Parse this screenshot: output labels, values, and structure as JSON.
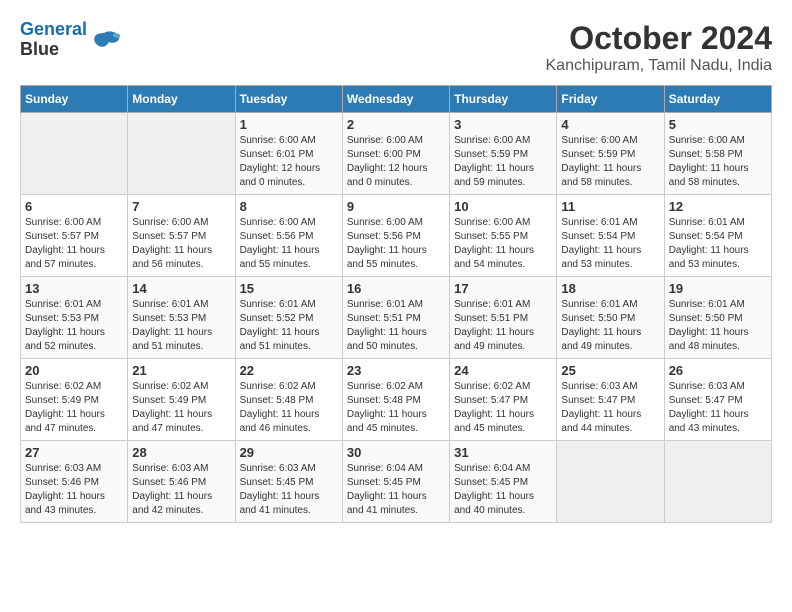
{
  "header": {
    "logo_line1": "General",
    "logo_line2": "Blue",
    "month": "October 2024",
    "location": "Kanchipuram, Tamil Nadu, India"
  },
  "weekdays": [
    "Sunday",
    "Monday",
    "Tuesday",
    "Wednesday",
    "Thursday",
    "Friday",
    "Saturday"
  ],
  "weeks": [
    [
      {
        "day": "",
        "info": ""
      },
      {
        "day": "",
        "info": ""
      },
      {
        "day": "1",
        "info": "Sunrise: 6:00 AM\nSunset: 6:01 PM\nDaylight: 12 hours\nand 0 minutes."
      },
      {
        "day": "2",
        "info": "Sunrise: 6:00 AM\nSunset: 6:00 PM\nDaylight: 12 hours\nand 0 minutes."
      },
      {
        "day": "3",
        "info": "Sunrise: 6:00 AM\nSunset: 5:59 PM\nDaylight: 11 hours\nand 59 minutes."
      },
      {
        "day": "4",
        "info": "Sunrise: 6:00 AM\nSunset: 5:59 PM\nDaylight: 11 hours\nand 58 minutes."
      },
      {
        "day": "5",
        "info": "Sunrise: 6:00 AM\nSunset: 5:58 PM\nDaylight: 11 hours\nand 58 minutes."
      }
    ],
    [
      {
        "day": "6",
        "info": "Sunrise: 6:00 AM\nSunset: 5:57 PM\nDaylight: 11 hours\nand 57 minutes."
      },
      {
        "day": "7",
        "info": "Sunrise: 6:00 AM\nSunset: 5:57 PM\nDaylight: 11 hours\nand 56 minutes."
      },
      {
        "day": "8",
        "info": "Sunrise: 6:00 AM\nSunset: 5:56 PM\nDaylight: 11 hours\nand 55 minutes."
      },
      {
        "day": "9",
        "info": "Sunrise: 6:00 AM\nSunset: 5:56 PM\nDaylight: 11 hours\nand 55 minutes."
      },
      {
        "day": "10",
        "info": "Sunrise: 6:00 AM\nSunset: 5:55 PM\nDaylight: 11 hours\nand 54 minutes."
      },
      {
        "day": "11",
        "info": "Sunrise: 6:01 AM\nSunset: 5:54 PM\nDaylight: 11 hours\nand 53 minutes."
      },
      {
        "day": "12",
        "info": "Sunrise: 6:01 AM\nSunset: 5:54 PM\nDaylight: 11 hours\nand 53 minutes."
      }
    ],
    [
      {
        "day": "13",
        "info": "Sunrise: 6:01 AM\nSunset: 5:53 PM\nDaylight: 11 hours\nand 52 minutes."
      },
      {
        "day": "14",
        "info": "Sunrise: 6:01 AM\nSunset: 5:53 PM\nDaylight: 11 hours\nand 51 minutes."
      },
      {
        "day": "15",
        "info": "Sunrise: 6:01 AM\nSunset: 5:52 PM\nDaylight: 11 hours\nand 51 minutes."
      },
      {
        "day": "16",
        "info": "Sunrise: 6:01 AM\nSunset: 5:51 PM\nDaylight: 11 hours\nand 50 minutes."
      },
      {
        "day": "17",
        "info": "Sunrise: 6:01 AM\nSunset: 5:51 PM\nDaylight: 11 hours\nand 49 minutes."
      },
      {
        "day": "18",
        "info": "Sunrise: 6:01 AM\nSunset: 5:50 PM\nDaylight: 11 hours\nand 49 minutes."
      },
      {
        "day": "19",
        "info": "Sunrise: 6:01 AM\nSunset: 5:50 PM\nDaylight: 11 hours\nand 48 minutes."
      }
    ],
    [
      {
        "day": "20",
        "info": "Sunrise: 6:02 AM\nSunset: 5:49 PM\nDaylight: 11 hours\nand 47 minutes."
      },
      {
        "day": "21",
        "info": "Sunrise: 6:02 AM\nSunset: 5:49 PM\nDaylight: 11 hours\nand 47 minutes."
      },
      {
        "day": "22",
        "info": "Sunrise: 6:02 AM\nSunset: 5:48 PM\nDaylight: 11 hours\nand 46 minutes."
      },
      {
        "day": "23",
        "info": "Sunrise: 6:02 AM\nSunset: 5:48 PM\nDaylight: 11 hours\nand 45 minutes."
      },
      {
        "day": "24",
        "info": "Sunrise: 6:02 AM\nSunset: 5:47 PM\nDaylight: 11 hours\nand 45 minutes."
      },
      {
        "day": "25",
        "info": "Sunrise: 6:03 AM\nSunset: 5:47 PM\nDaylight: 11 hours\nand 44 minutes."
      },
      {
        "day": "26",
        "info": "Sunrise: 6:03 AM\nSunset: 5:47 PM\nDaylight: 11 hours\nand 43 minutes."
      }
    ],
    [
      {
        "day": "27",
        "info": "Sunrise: 6:03 AM\nSunset: 5:46 PM\nDaylight: 11 hours\nand 43 minutes."
      },
      {
        "day": "28",
        "info": "Sunrise: 6:03 AM\nSunset: 5:46 PM\nDaylight: 11 hours\nand 42 minutes."
      },
      {
        "day": "29",
        "info": "Sunrise: 6:03 AM\nSunset: 5:45 PM\nDaylight: 11 hours\nand 41 minutes."
      },
      {
        "day": "30",
        "info": "Sunrise: 6:04 AM\nSunset: 5:45 PM\nDaylight: 11 hours\nand 41 minutes."
      },
      {
        "day": "31",
        "info": "Sunrise: 6:04 AM\nSunset: 5:45 PM\nDaylight: 11 hours\nand 40 minutes."
      },
      {
        "day": "",
        "info": ""
      },
      {
        "day": "",
        "info": ""
      }
    ]
  ]
}
